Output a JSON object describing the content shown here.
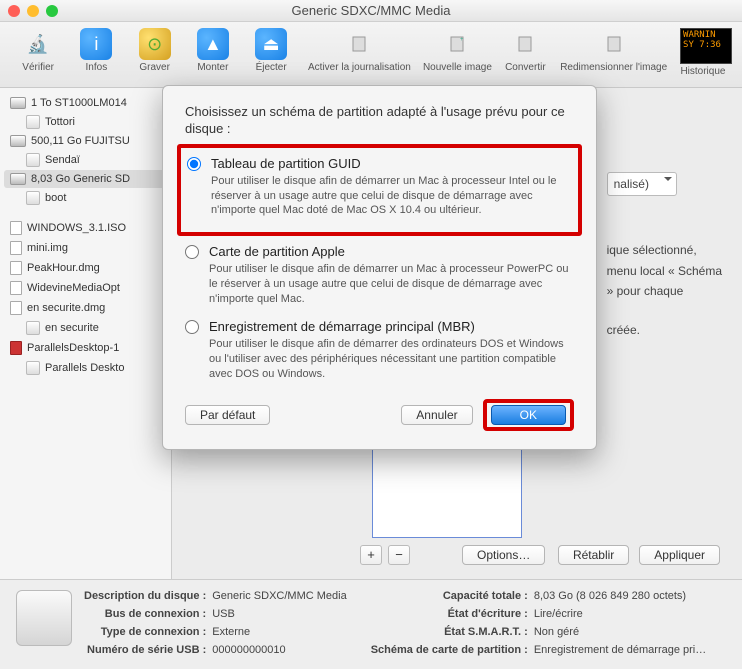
{
  "window": {
    "title": "Generic SDXC/MMC Media"
  },
  "toolbar": {
    "verify": "Vérifier",
    "info": "Infos",
    "burn": "Graver",
    "mount": "Monter",
    "eject": "Éjecter",
    "journal": "Activer la journalisation",
    "newimg": "Nouvelle image",
    "convert": "Convertir",
    "resize": "Redimensionner l'image",
    "history": "Historique",
    "warn_line1": "WARNIN",
    "warn_line2": "SY 7:36"
  },
  "sidebar": {
    "items": [
      {
        "label": "1 To ST1000LM014",
        "kind": "disk"
      },
      {
        "label": "Tottori",
        "kind": "vol"
      },
      {
        "label": "500,11 Go FUJITSU",
        "kind": "disk"
      },
      {
        "label": "Sendaï",
        "kind": "vol"
      },
      {
        "label": "8,03 Go Generic SD",
        "kind": "disk",
        "sel": true
      },
      {
        "label": "boot",
        "kind": "vol"
      },
      {
        "label": "WINDOWS_3.1.ISO",
        "kind": "file"
      },
      {
        "label": "mini.img",
        "kind": "file"
      },
      {
        "label": "PeakHour.dmg",
        "kind": "file"
      },
      {
        "label": "WidevineMediaOpt",
        "kind": "file"
      },
      {
        "label": "en securite.dmg",
        "kind": "file"
      },
      {
        "label": "en securite",
        "kind": "vol"
      },
      {
        "label": "ParallelsDesktop-1",
        "kind": "file-red"
      },
      {
        "label": "Parallels Deskto",
        "kind": "vol"
      }
    ]
  },
  "main": {
    "scheme_selected_suffix": "nalisé)",
    "hint_lines": [
      "ique sélectionné,",
      "menu local « Schéma",
      "» pour chaque",
      "",
      "créée."
    ],
    "options_btn": "Options…",
    "revert_btn": "Rétablir",
    "apply_btn": "Appliquer"
  },
  "dialog": {
    "heading": "Choisissez un schéma de partition adapté à l'usage prévu pour ce disque :",
    "options": [
      {
        "title": "Tableau de partition GUID",
        "desc": "Pour utiliser le disque afin de démarrer un Mac à processeur Intel ou le réserver à un usage autre que celui de disque de démarrage avec n'importe quel Mac doté de Mac OS X 10.4 ou ultérieur."
      },
      {
        "title": "Carte de partition Apple",
        "desc": "Pour utiliser le disque afin de démarrer un Mac à processeur PowerPC ou le réserver à un usage autre que celui de disque de démarrage avec n'importe quel Mac."
      },
      {
        "title": "Enregistrement de démarrage principal (MBR)",
        "desc": "Pour utiliser le disque afin de démarrer des ordinateurs DOS et Windows ou l'utiliser avec des périphériques nécessitant une partition compatible avec DOS ou Windows."
      }
    ],
    "default_btn": "Par défaut",
    "cancel_btn": "Annuler",
    "ok_btn": "OK"
  },
  "footer": {
    "left": {
      "desc_k": "Description du disque :",
      "desc_v": "Generic SDXC/MMC Media",
      "bus_k": "Bus de connexion :",
      "bus_v": "USB",
      "type_k": "Type de connexion :",
      "type_v": "Externe",
      "serial_k": "Numéro de série USB :",
      "serial_v": "000000000010"
    },
    "right": {
      "cap_k": "Capacité totale :",
      "cap_v": "8,03 Go (8 026 849 280 octets)",
      "rw_k": "État d'écriture :",
      "rw_v": "Lire/écrire",
      "smart_k": "État S.M.A.R.T. :",
      "smart_v": "Non géré",
      "map_k": "Schéma de carte de partition :",
      "map_v": "Enregistrement de démarrage pri…"
    }
  }
}
